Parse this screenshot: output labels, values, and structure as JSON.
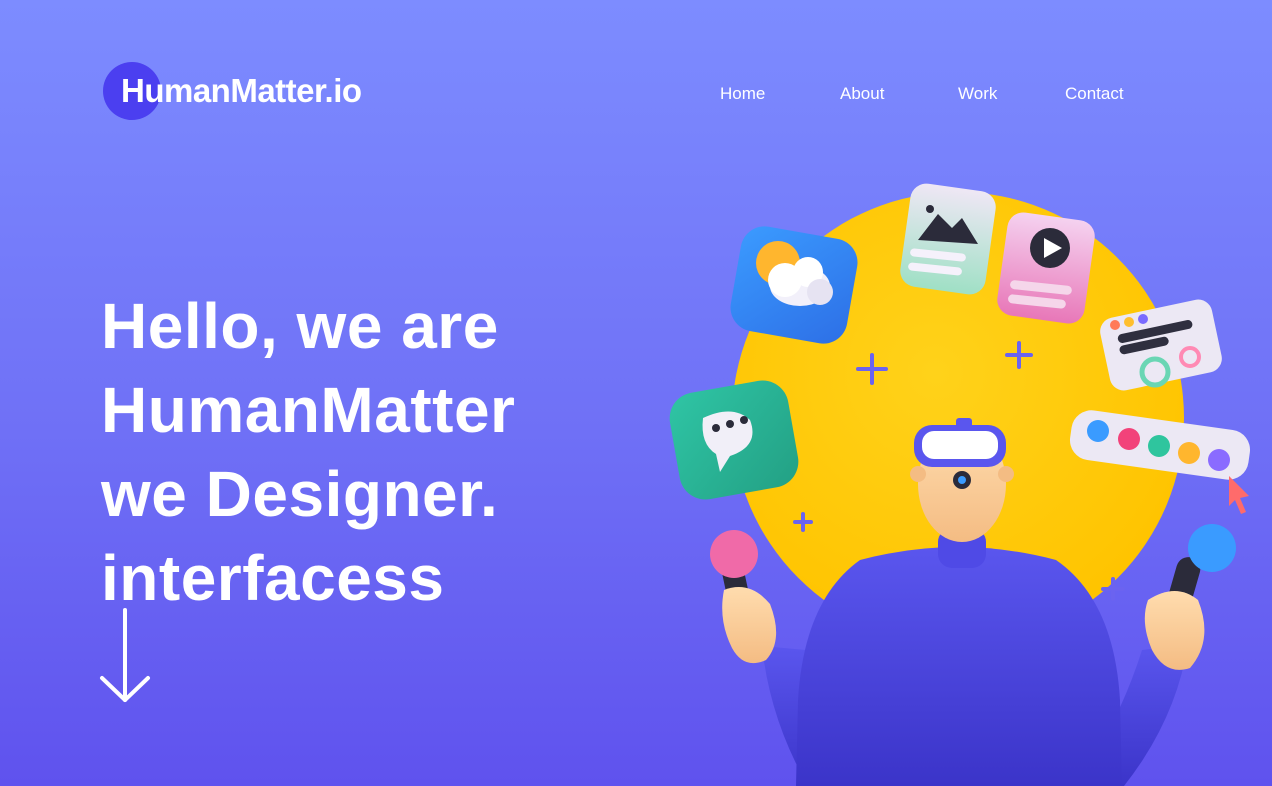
{
  "brand": {
    "name": "HumanMatter.io"
  },
  "nav": {
    "items": [
      "Home",
      "About",
      "Work",
      "Contact"
    ]
  },
  "hero": {
    "lines": [
      "Hello, we are",
      "HumanMatter",
      "we Designer.",
      "interfacess"
    ]
  },
  "colors": {
    "accent": "#4b3ff0",
    "circle": "#ffcc00",
    "background_top": "#7d8cff",
    "background_bottom": "#5f52ee"
  },
  "icons": [
    "arrow-down-icon",
    "weather-icon",
    "image-card-icon",
    "play-card-icon",
    "chat-bubble-icon",
    "text-card-icon",
    "color-palette-icon",
    "cursor-icon"
  ]
}
